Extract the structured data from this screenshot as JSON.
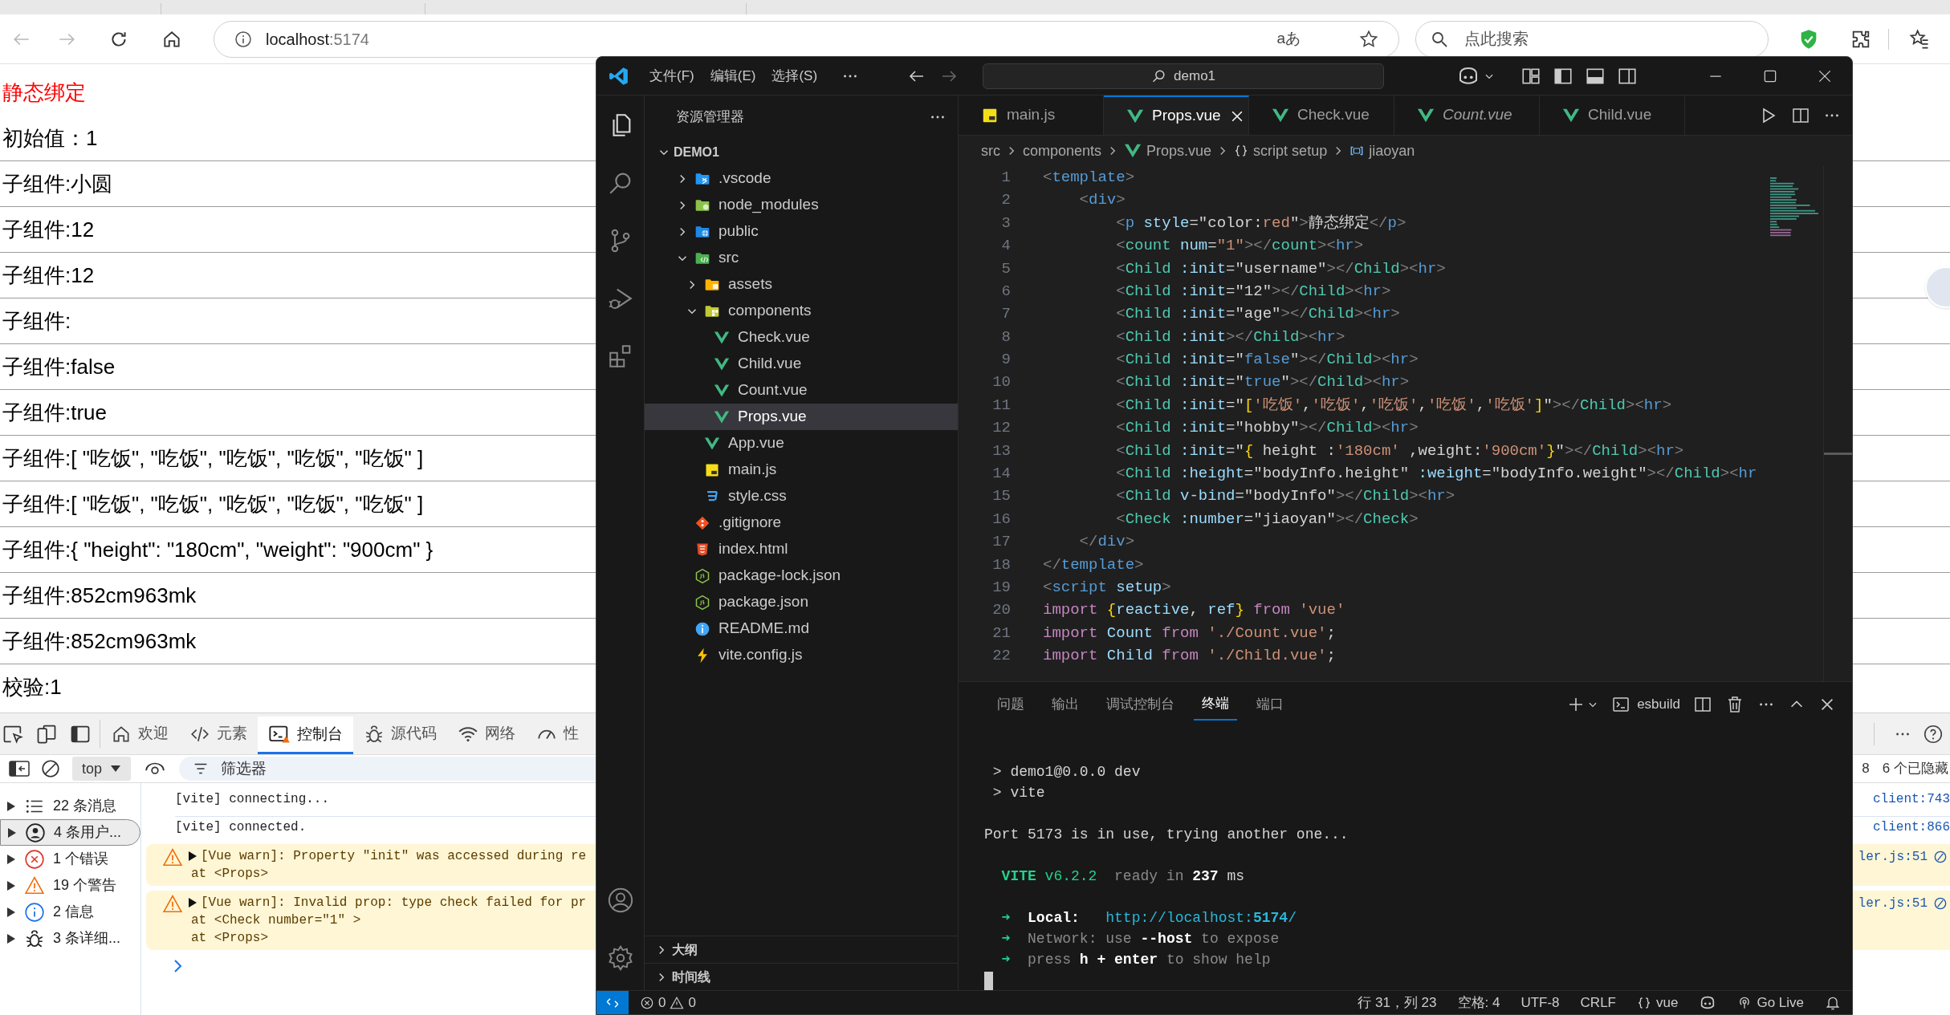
{
  "browser": {
    "address": {
      "host": "localhost",
      "port": ":5174"
    },
    "translate_glyph": "aあ",
    "search_placeholder": "点此搜索"
  },
  "page": {
    "lines": [
      {
        "text": "静态绑定",
        "color": "#ff0000",
        "rule": false
      },
      {
        "text": "初始值：1",
        "color": "#000000",
        "rule": true
      },
      {
        "text": "子组件:小圆",
        "color": "#000000",
        "rule": true
      },
      {
        "text": "子组件:12",
        "color": "#000000",
        "rule": true
      },
      {
        "text": "子组件:12",
        "color": "#000000",
        "rule": true
      },
      {
        "text": "子组件:",
        "color": "#000000",
        "rule": true
      },
      {
        "text": "子组件:false",
        "color": "#000000",
        "rule": true
      },
      {
        "text": "子组件:true",
        "color": "#000000",
        "rule": true
      },
      {
        "text": "子组件:[ \"吃饭\", \"吃饭\", \"吃饭\", \"吃饭\", \"吃饭\" ]",
        "color": "#000000",
        "rule": true
      },
      {
        "text": "子组件:[ \"吃饭\", \"吃饭\", \"吃饭\", \"吃饭\", \"吃饭\" ]",
        "color": "#000000",
        "rule": true
      },
      {
        "text": "子组件:{ \"height\": \"180cm\", \"weight\": \"900cm\" }",
        "color": "#000000",
        "rule": true
      },
      {
        "text": "子组件:852cm963mk",
        "color": "#000000",
        "rule": true
      },
      {
        "text": "子组件:852cm963mk",
        "color": "#000000",
        "rule": true
      },
      {
        "text": "校验:1",
        "color": "#000000",
        "rule": false
      }
    ]
  },
  "devtools": {
    "tabs": [
      {
        "label": "欢迎",
        "kind": "home",
        "selected": false
      },
      {
        "label": "元素",
        "kind": "code",
        "selected": false
      },
      {
        "label": "控制台",
        "kind": "console",
        "selected": true
      },
      {
        "label": "源代码",
        "kind": "bug",
        "selected": false
      },
      {
        "label": "网络",
        "kind": "wifi",
        "selected": false
      },
      {
        "label": "性",
        "kind": "gauge",
        "selected": false
      }
    ],
    "context": "top",
    "filter_placeholder": "筛选器",
    "count": "8",
    "hidden": "6 个已隐藏",
    "sidebar": [
      {
        "label": "22 条消息",
        "kind": "list",
        "selected": false
      },
      {
        "label": "4 条用户...",
        "kind": "user",
        "selected": true
      },
      {
        "label": "1 个错误",
        "kind": "error",
        "selected": false
      },
      {
        "label": "19 个警告",
        "kind": "warning",
        "selected": false
      },
      {
        "label": "2 信息",
        "kind": "info",
        "selected": false
      },
      {
        "label": "3 条详细...",
        "kind": "bug",
        "selected": false
      }
    ],
    "messages": [
      {
        "kind": "log",
        "lines": [
          "[vite] connecting..."
        ],
        "source": "client:743"
      },
      {
        "kind": "log",
        "lines": [
          "[vite] connected."
        ],
        "source": "client:866"
      },
      {
        "kind": "warning",
        "lines": [
          "[Vue warn]: Property \"init\" was accessed during re",
          "at <Props>"
        ],
        "source": "ler.js:51"
      },
      {
        "kind": "warning",
        "lines": [
          "[Vue warn]: Invalid prop: type check failed for pr",
          "at <Check number=\"1\" >",
          "at <Props>"
        ],
        "source": "ler.js:51"
      }
    ]
  },
  "vscode": {
    "menus": [
      "文件(F)",
      "编辑(E)",
      "选择(S)"
    ],
    "command_center": "demo1",
    "explorer": {
      "title": "资源管理器",
      "tree": [
        {
          "label": "DEMO1",
          "kind": "root",
          "expanded": true,
          "selected": false,
          "children": [
            {
              "label": ".vscode",
              "kind": "folder-vscode",
              "expanded": false,
              "selected": false
            },
            {
              "label": "node_modules",
              "kind": "folder-node",
              "expanded": false,
              "selected": false
            },
            {
              "label": "public",
              "kind": "folder-public",
              "expanded": false,
              "selected": false
            },
            {
              "label": "src",
              "kind": "folder-src",
              "expanded": true,
              "selected": false,
              "children": [
                {
                  "label": "assets",
                  "kind": "folder-assets",
                  "expanded": false,
                  "selected": false
                },
                {
                  "label": "components",
                  "kind": "folder-components",
                  "expanded": true,
                  "selected": false,
                  "children": [
                    {
                      "label": "Check.vue",
                      "kind": "vue",
                      "selected": false
                    },
                    {
                      "label": "Child.vue",
                      "kind": "vue",
                      "selected": false
                    },
                    {
                      "label": "Count.vue",
                      "kind": "vue",
                      "selected": false
                    },
                    {
                      "label": "Props.vue",
                      "kind": "vue",
                      "selected": true
                    }
                  ]
                },
                {
                  "label": "App.vue",
                  "kind": "vue",
                  "selected": false
                },
                {
                  "label": "main.js",
                  "kind": "js",
                  "selected": false
                },
                {
                  "label": "style.css",
                  "kind": "css",
                  "selected": false
                }
              ]
            },
            {
              "label": ".gitignore",
              "kind": "git",
              "selected": false
            },
            {
              "label": "index.html",
              "kind": "html",
              "selected": false
            },
            {
              "label": "package-lock.json",
              "kind": "json",
              "selected": false
            },
            {
              "label": "package.json",
              "kind": "json",
              "selected": false
            },
            {
              "label": "README.md",
              "kind": "info",
              "selected": false
            },
            {
              "label": "vite.config.js",
              "kind": "vite",
              "selected": false
            }
          ]
        }
      ]
    },
    "sections": [
      {
        "label": "大纲",
        "expanded": false
      },
      {
        "label": "时间线",
        "expanded": false
      }
    ],
    "tabs": [
      {
        "label": "main.js",
        "kind": "js",
        "selected": false,
        "preview": false
      },
      {
        "label": "Props.vue",
        "kind": "vue",
        "selected": true,
        "preview": false
      },
      {
        "label": "Check.vue",
        "kind": "vue",
        "selected": false,
        "preview": false
      },
      {
        "label": "Count.vue",
        "kind": "vue",
        "selected": false,
        "preview": true
      },
      {
        "label": "Child.vue",
        "kind": "vue",
        "selected": false,
        "preview": false
      }
    ],
    "breadcrumbs": [
      {
        "label": "src",
        "kind": "plain"
      },
      {
        "label": "components",
        "kind": "plain"
      },
      {
        "label": "Props.vue",
        "kind": "vue"
      },
      {
        "label": "script setup",
        "kind": "braces"
      },
      {
        "label": "jiaoyan",
        "kind": "variable"
      }
    ],
    "code": [
      {
        "n": "1",
        "t": [
          {
            "text": "<",
            "kind": "punct"
          },
          {
            "text": "template",
            "kind": "tag"
          },
          {
            "text": ">",
            "kind": "punct"
          }
        ]
      },
      {
        "n": "2",
        "t": [
          {
            "text": "    <",
            "kind": "punct"
          },
          {
            "text": "div",
            "kind": "tag"
          },
          {
            "text": ">",
            "kind": "punct"
          }
        ]
      },
      {
        "n": "3",
        "t": [
          {
            "text": "        <",
            "kind": "punct"
          },
          {
            "text": "p",
            "kind": "tag"
          },
          {
            "text": " style",
            "kind": "attr"
          },
          {
            "text": "=\"color:",
            "kind": "plain"
          },
          {
            "text": "red",
            "kind": "string"
          },
          {
            "text": "\"",
            "kind": "plain"
          },
          {
            "text": ">",
            "kind": "punct"
          },
          {
            "text": "静态绑定",
            "kind": "plain"
          },
          {
            "text": "</",
            "kind": "punct"
          },
          {
            "text": "p",
            "kind": "tag"
          },
          {
            "text": ">",
            "kind": "punct"
          }
        ]
      },
      {
        "n": "4",
        "t": [
          {
            "text": "        <",
            "kind": "punct"
          },
          {
            "text": "count",
            "kind": "component"
          },
          {
            "text": " num",
            "kind": "attr"
          },
          {
            "text": "=",
            "kind": "plain"
          },
          {
            "text": "\"1\"",
            "kind": "string"
          },
          {
            "text": "></",
            "kind": "punct"
          },
          {
            "text": "count",
            "kind": "component"
          },
          {
            "text": "><",
            "kind": "punct"
          },
          {
            "text": "hr",
            "kind": "tag"
          },
          {
            "text": ">",
            "kind": "punct"
          }
        ]
      },
      {
        "n": "5",
        "t": [
          {
            "text": "        <",
            "kind": "punct"
          },
          {
            "text": "Child",
            "kind": "component"
          },
          {
            "text": " :init",
            "kind": "attr"
          },
          {
            "text": "=\"username\"",
            "kind": "plain"
          },
          {
            "text": "></",
            "kind": "punct"
          },
          {
            "text": "Child",
            "kind": "component"
          },
          {
            "text": "><",
            "kind": "punct"
          },
          {
            "text": "hr",
            "kind": "tag"
          },
          {
            "text": ">",
            "kind": "punct"
          }
        ]
      },
      {
        "n": "6",
        "t": [
          {
            "text": "        <",
            "kind": "punct"
          },
          {
            "text": "Child",
            "kind": "component"
          },
          {
            "text": " :init",
            "kind": "attr"
          },
          {
            "text": "=\"12\"",
            "kind": "plain"
          },
          {
            "text": "></",
            "kind": "punct"
          },
          {
            "text": "Child",
            "kind": "component"
          },
          {
            "text": "><",
            "kind": "punct"
          },
          {
            "text": "hr",
            "kind": "tag"
          },
          {
            "text": ">",
            "kind": "punct"
          }
        ]
      },
      {
        "n": "7",
        "t": [
          {
            "text": "        <",
            "kind": "punct"
          },
          {
            "text": "Child",
            "kind": "component"
          },
          {
            "text": " :init",
            "kind": "attr"
          },
          {
            "text": "=\"age\"",
            "kind": "plain"
          },
          {
            "text": "></",
            "kind": "punct"
          },
          {
            "text": "Child",
            "kind": "component"
          },
          {
            "text": "><",
            "kind": "punct"
          },
          {
            "text": "hr",
            "kind": "tag"
          },
          {
            "text": ">",
            "kind": "punct"
          }
        ]
      },
      {
        "n": "8",
        "t": [
          {
            "text": "        <",
            "kind": "punct"
          },
          {
            "text": "Child",
            "kind": "component"
          },
          {
            "text": " :init",
            "kind": "attr"
          },
          {
            "text": "></",
            "kind": "punct"
          },
          {
            "text": "Child",
            "kind": "component"
          },
          {
            "text": "><",
            "kind": "punct"
          },
          {
            "text": "hr",
            "kind": "tag"
          },
          {
            "text": ">",
            "kind": "punct"
          }
        ]
      },
      {
        "n": "9",
        "t": [
          {
            "text": "        <",
            "kind": "punct"
          },
          {
            "text": "Child",
            "kind": "component"
          },
          {
            "text": " :init",
            "kind": "attr"
          },
          {
            "text": "=\"",
            "kind": "plain"
          },
          {
            "text": "false",
            "kind": "keyword"
          },
          {
            "text": "\"",
            "kind": "plain"
          },
          {
            "text": "></",
            "kind": "punct"
          },
          {
            "text": "Child",
            "kind": "component"
          },
          {
            "text": "><",
            "kind": "punct"
          },
          {
            "text": "hr",
            "kind": "tag"
          },
          {
            "text": ">",
            "kind": "punct"
          }
        ]
      },
      {
        "n": "10",
        "t": [
          {
            "text": "        <",
            "kind": "punct"
          },
          {
            "text": "Child",
            "kind": "component"
          },
          {
            "text": " :init",
            "kind": "attr"
          },
          {
            "text": "=\"",
            "kind": "plain"
          },
          {
            "text": "true",
            "kind": "keyword"
          },
          {
            "text": "\"",
            "kind": "plain"
          },
          {
            "text": "></",
            "kind": "punct"
          },
          {
            "text": "Child",
            "kind": "component"
          },
          {
            "text": "><",
            "kind": "punct"
          },
          {
            "text": "hr",
            "kind": "tag"
          },
          {
            "text": ">",
            "kind": "punct"
          }
        ]
      },
      {
        "n": "11",
        "t": [
          {
            "text": "        <",
            "kind": "punct"
          },
          {
            "text": "Child",
            "kind": "component"
          },
          {
            "text": " :init",
            "kind": "attr"
          },
          {
            "text": "=\"",
            "kind": "plain"
          },
          {
            "text": "[",
            "kind": "bracket"
          },
          {
            "text": "'吃饭'",
            "kind": "string"
          },
          {
            "text": ",",
            "kind": "plain"
          },
          {
            "text": "'吃饭'",
            "kind": "string"
          },
          {
            "text": ",",
            "kind": "plain"
          },
          {
            "text": "'吃饭'",
            "kind": "string"
          },
          {
            "text": ",",
            "kind": "plain"
          },
          {
            "text": "'吃饭'",
            "kind": "string"
          },
          {
            "text": ",",
            "kind": "plain"
          },
          {
            "text": "'吃饭'",
            "kind": "string"
          },
          {
            "text": "]",
            "kind": "bracket"
          },
          {
            "text": "\"",
            "kind": "plain"
          },
          {
            "text": "></",
            "kind": "punct"
          },
          {
            "text": "Child",
            "kind": "component"
          },
          {
            "text": "><",
            "kind": "punct"
          },
          {
            "text": "hr",
            "kind": "tag"
          },
          {
            "text": ">",
            "kind": "punct"
          }
        ]
      },
      {
        "n": "12",
        "t": [
          {
            "text": "        <",
            "kind": "punct"
          },
          {
            "text": "Child",
            "kind": "component"
          },
          {
            "text": " :init",
            "kind": "attr"
          },
          {
            "text": "=\"hobby\"",
            "kind": "plain"
          },
          {
            "text": "></",
            "kind": "punct"
          },
          {
            "text": "Child",
            "kind": "component"
          },
          {
            "text": "><",
            "kind": "punct"
          },
          {
            "text": "hr",
            "kind": "tag"
          },
          {
            "text": ">",
            "kind": "punct"
          }
        ]
      },
      {
        "n": "13",
        "t": [
          {
            "text": "        <",
            "kind": "punct"
          },
          {
            "text": "Child",
            "kind": "component"
          },
          {
            "text": " :init",
            "kind": "attr"
          },
          {
            "text": "=\"",
            "kind": "plain"
          },
          {
            "text": "{",
            "kind": "bracket"
          },
          {
            "text": " height :",
            "kind": "plain"
          },
          {
            "text": "'180cm'",
            "kind": "string"
          },
          {
            "text": " ,weight:",
            "kind": "plain"
          },
          {
            "text": "'900cm'",
            "kind": "string"
          },
          {
            "text": "}",
            "kind": "bracket"
          },
          {
            "text": "\"",
            "kind": "plain"
          },
          {
            "text": "></",
            "kind": "punct"
          },
          {
            "text": "Child",
            "kind": "component"
          },
          {
            "text": "><",
            "kind": "punct"
          },
          {
            "text": "hr",
            "kind": "tag"
          },
          {
            "text": ">",
            "kind": "punct"
          }
        ]
      },
      {
        "n": "14",
        "t": [
          {
            "text": "        <",
            "kind": "punct"
          },
          {
            "text": "Child",
            "kind": "component"
          },
          {
            "text": " :height",
            "kind": "attr"
          },
          {
            "text": "=\"bodyInfo.height\"",
            "kind": "plain"
          },
          {
            "text": " :weight",
            "kind": "attr"
          },
          {
            "text": "=\"bodyInfo.weight\"",
            "kind": "plain"
          },
          {
            "text": "></",
            "kind": "punct"
          },
          {
            "text": "Child",
            "kind": "component"
          },
          {
            "text": "><",
            "kind": "punct"
          },
          {
            "text": "hr",
            "kind": "tag"
          }
        ]
      },
      {
        "n": "15",
        "t": [
          {
            "text": "        <",
            "kind": "punct"
          },
          {
            "text": "Child",
            "kind": "component"
          },
          {
            "text": " v-bind",
            "kind": "attr"
          },
          {
            "text": "=\"bodyInfo\"",
            "kind": "plain"
          },
          {
            "text": "></",
            "kind": "punct"
          },
          {
            "text": "Child",
            "kind": "component"
          },
          {
            "text": "><",
            "kind": "punct"
          },
          {
            "text": "hr",
            "kind": "tag"
          },
          {
            "text": ">",
            "kind": "punct"
          }
        ]
      },
      {
        "n": "16",
        "t": [
          {
            "text": "        <",
            "kind": "punct"
          },
          {
            "text": "Check",
            "kind": "component"
          },
          {
            "text": " :number",
            "kind": "attr"
          },
          {
            "text": "=\"jiaoyan\"",
            "kind": "plain"
          },
          {
            "text": "></",
            "kind": "punct"
          },
          {
            "text": "Check",
            "kind": "component"
          },
          {
            "text": ">",
            "kind": "punct"
          }
        ]
      },
      {
        "n": "17",
        "t": [
          {
            "text": "    </",
            "kind": "punct"
          },
          {
            "text": "div",
            "kind": "tag"
          },
          {
            "text": ">",
            "kind": "punct"
          }
        ]
      },
      {
        "n": "18",
        "t": [
          {
            "text": "</",
            "kind": "punct"
          },
          {
            "text": "template",
            "kind": "tag"
          },
          {
            "text": ">",
            "kind": "punct"
          }
        ]
      },
      {
        "n": "19",
        "t": [
          {
            "text": "<",
            "kind": "punct"
          },
          {
            "text": "script",
            "kind": "tag"
          },
          {
            "text": " setup",
            "kind": "attr"
          },
          {
            "text": ">",
            "kind": "punct"
          }
        ]
      },
      {
        "n": "20",
        "t": [
          {
            "text": "import ",
            "kind": "import"
          },
          {
            "text": "{",
            "kind": "bracket"
          },
          {
            "text": "reactive",
            "kind": "variable"
          },
          {
            "text": ", ",
            "kind": "plain"
          },
          {
            "text": "ref",
            "kind": "variable"
          },
          {
            "text": "}",
            "kind": "bracket"
          },
          {
            "text": " from ",
            "kind": "import"
          },
          {
            "text": "'vue'",
            "kind": "string"
          }
        ]
      },
      {
        "n": "21",
        "t": [
          {
            "text": "import ",
            "kind": "import"
          },
          {
            "text": "Count",
            "kind": "variable"
          },
          {
            "text": " from ",
            "kind": "import"
          },
          {
            "text": "'./Count.vue'",
            "kind": "string"
          },
          {
            "text": ";",
            "kind": "plain"
          }
        ]
      },
      {
        "n": "22",
        "t": [
          {
            "text": "import ",
            "kind": "import"
          },
          {
            "text": "Child",
            "kind": "variable"
          },
          {
            "text": " from ",
            "kind": "import"
          },
          {
            "text": "'./Child.vue'",
            "kind": "string"
          },
          {
            "text": ";",
            "kind": "plain"
          }
        ]
      }
    ],
    "panel": {
      "tabs": [
        {
          "label": "问题",
          "selected": false
        },
        {
          "label": "输出",
          "selected": false
        },
        {
          "label": "调试控制台",
          "selected": false
        },
        {
          "label": "终端",
          "selected": true
        },
        {
          "label": "端口",
          "selected": false
        }
      ],
      "profile": "esbuild",
      "groups": [
        {
          "lines": [
            {
              "t": [
                {
                  "text": " > demo1@0.0.0 dev",
                  "kind": "text"
                }
              ]
            },
            {
              "t": [
                {
                  "text": " > vite",
                  "kind": "text"
                }
              ]
            }
          ]
        },
        {
          "lines": [
            {
              "t": [
                {
                  "text": "Port 5173 is in use, trying another one...",
                  "kind": "text"
                }
              ]
            }
          ]
        },
        {
          "lines": [
            {
              "t": [
                {
                  "text": "  VITE",
                  "kind": "title"
                },
                {
                  "text": " v6.2.2",
                  "kind": "success"
                },
                {
                  "text": "  ready in ",
                  "kind": "dim"
                },
                {
                  "text": "237",
                  "kind": "strong"
                },
                {
                  "text": " ms",
                  "kind": "text"
                }
              ]
            }
          ]
        },
        {
          "lines": [
            {
              "t": [
                {
                  "text": "  ➜  ",
                  "kind": "success"
                },
                {
                  "text": "Local:   ",
                  "kind": "strong"
                },
                {
                  "text": "http://localhost:",
                  "kind": "link"
                },
                {
                  "text": "5174",
                  "kind": "linkstrong"
                },
                {
                  "text": "/",
                  "kind": "link"
                }
              ]
            },
            {
              "t": [
                {
                  "text": "  ➜  ",
                  "kind": "success"
                },
                {
                  "text": "Network: use ",
                  "kind": "dim"
                },
                {
                  "text": "--host",
                  "kind": "strong"
                },
                {
                  "text": " to expose",
                  "kind": "dim"
                }
              ]
            },
            {
              "t": [
                {
                  "text": "  ➜  ",
                  "kind": "success"
                },
                {
                  "text": "press ",
                  "kind": "dim"
                },
                {
                  "text": "h + enter",
                  "kind": "strong"
                },
                {
                  "text": " to show help",
                  "kind": "dim"
                }
              ]
            }
          ]
        }
      ]
    },
    "status": {
      "errors": "0",
      "warnings": "0",
      "items": [
        {
          "label": "行 31，列 23",
          "kind": "plain"
        },
        {
          "label": "空格: 4",
          "kind": "plain"
        },
        {
          "label": "UTF-8",
          "kind": "plain"
        },
        {
          "label": "CRLF",
          "kind": "plain"
        },
        {
          "label": "vue",
          "kind": "braces"
        },
        {
          "label": "Go Live",
          "kind": "broadcast"
        }
      ]
    }
  }
}
